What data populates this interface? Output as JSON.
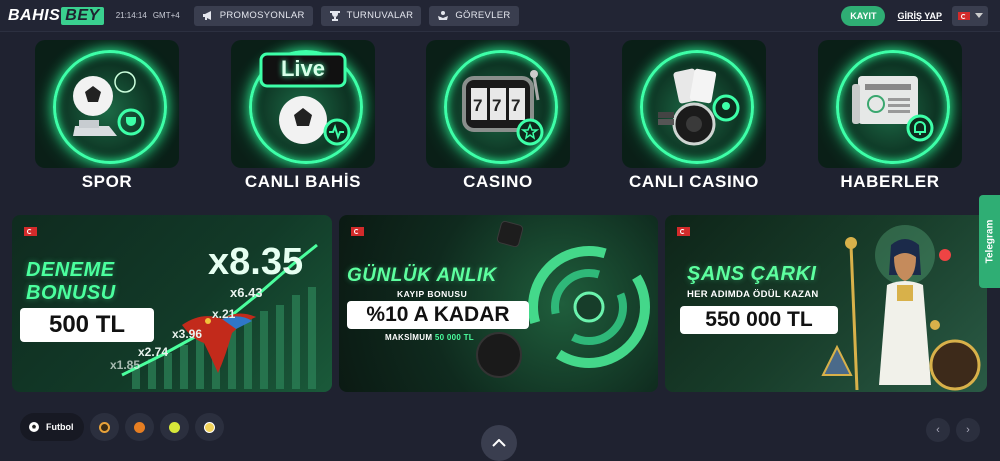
{
  "header": {
    "logo_part1": "BAHIS",
    "logo_part2": "BEY",
    "clock": "21:14:14",
    "timezone": "GMT+4",
    "nav": [
      {
        "label": "PROMOSYONLAR",
        "icon": "megaphone-icon"
      },
      {
        "label": "TURNUVALAR",
        "icon": "trophy-icon"
      },
      {
        "label": "GÖREVLER",
        "icon": "quest-icon"
      }
    ],
    "register_label": "KAYIT",
    "login_label": "GİRİŞ YAP",
    "language_flag": "turkey-flag-icon"
  },
  "categories": [
    {
      "label": "SPOR",
      "icon": "soccer-ball-icon"
    },
    {
      "label": "CANLI BAHİS",
      "icon": "live-soccer-icon",
      "badge": "Live"
    },
    {
      "label": "CASINO",
      "icon": "slot-machine-icon"
    },
    {
      "label": "CANLI CASINO",
      "icon": "roulette-cards-icon"
    },
    {
      "label": "HABERLER",
      "icon": "newspaper-icon"
    }
  ],
  "banners": [
    {
      "title_line1": "DENEME",
      "title_line2": "BONUSU",
      "amount": "500 TL",
      "multipliers": [
        "x8.35",
        "x6.43",
        "x3.96",
        "x2.74",
        "x1.85",
        "x.21"
      ]
    },
    {
      "title": "GÜNLÜK ANLIK",
      "subtitle": "KAYIP BONUSU",
      "amount": "%10 A KADAR",
      "max_label": "MAKSİMUM",
      "max_value": "50 000 TL"
    },
    {
      "title": "ŞANS ÇARKI",
      "subtitle": "HER ADIMDA ÖDÜL KAZAN",
      "amount": "550 000 TL"
    }
  ],
  "telegram_label": "Telegram",
  "sports_filter": {
    "active": "Futbol",
    "icons": [
      "esports-icon",
      "basketball-icon",
      "tennis-icon",
      "volleyball-icon"
    ]
  },
  "colors": {
    "accent": "#2fae74",
    "neon": "#4bff9e",
    "background": "#1f2230"
  }
}
